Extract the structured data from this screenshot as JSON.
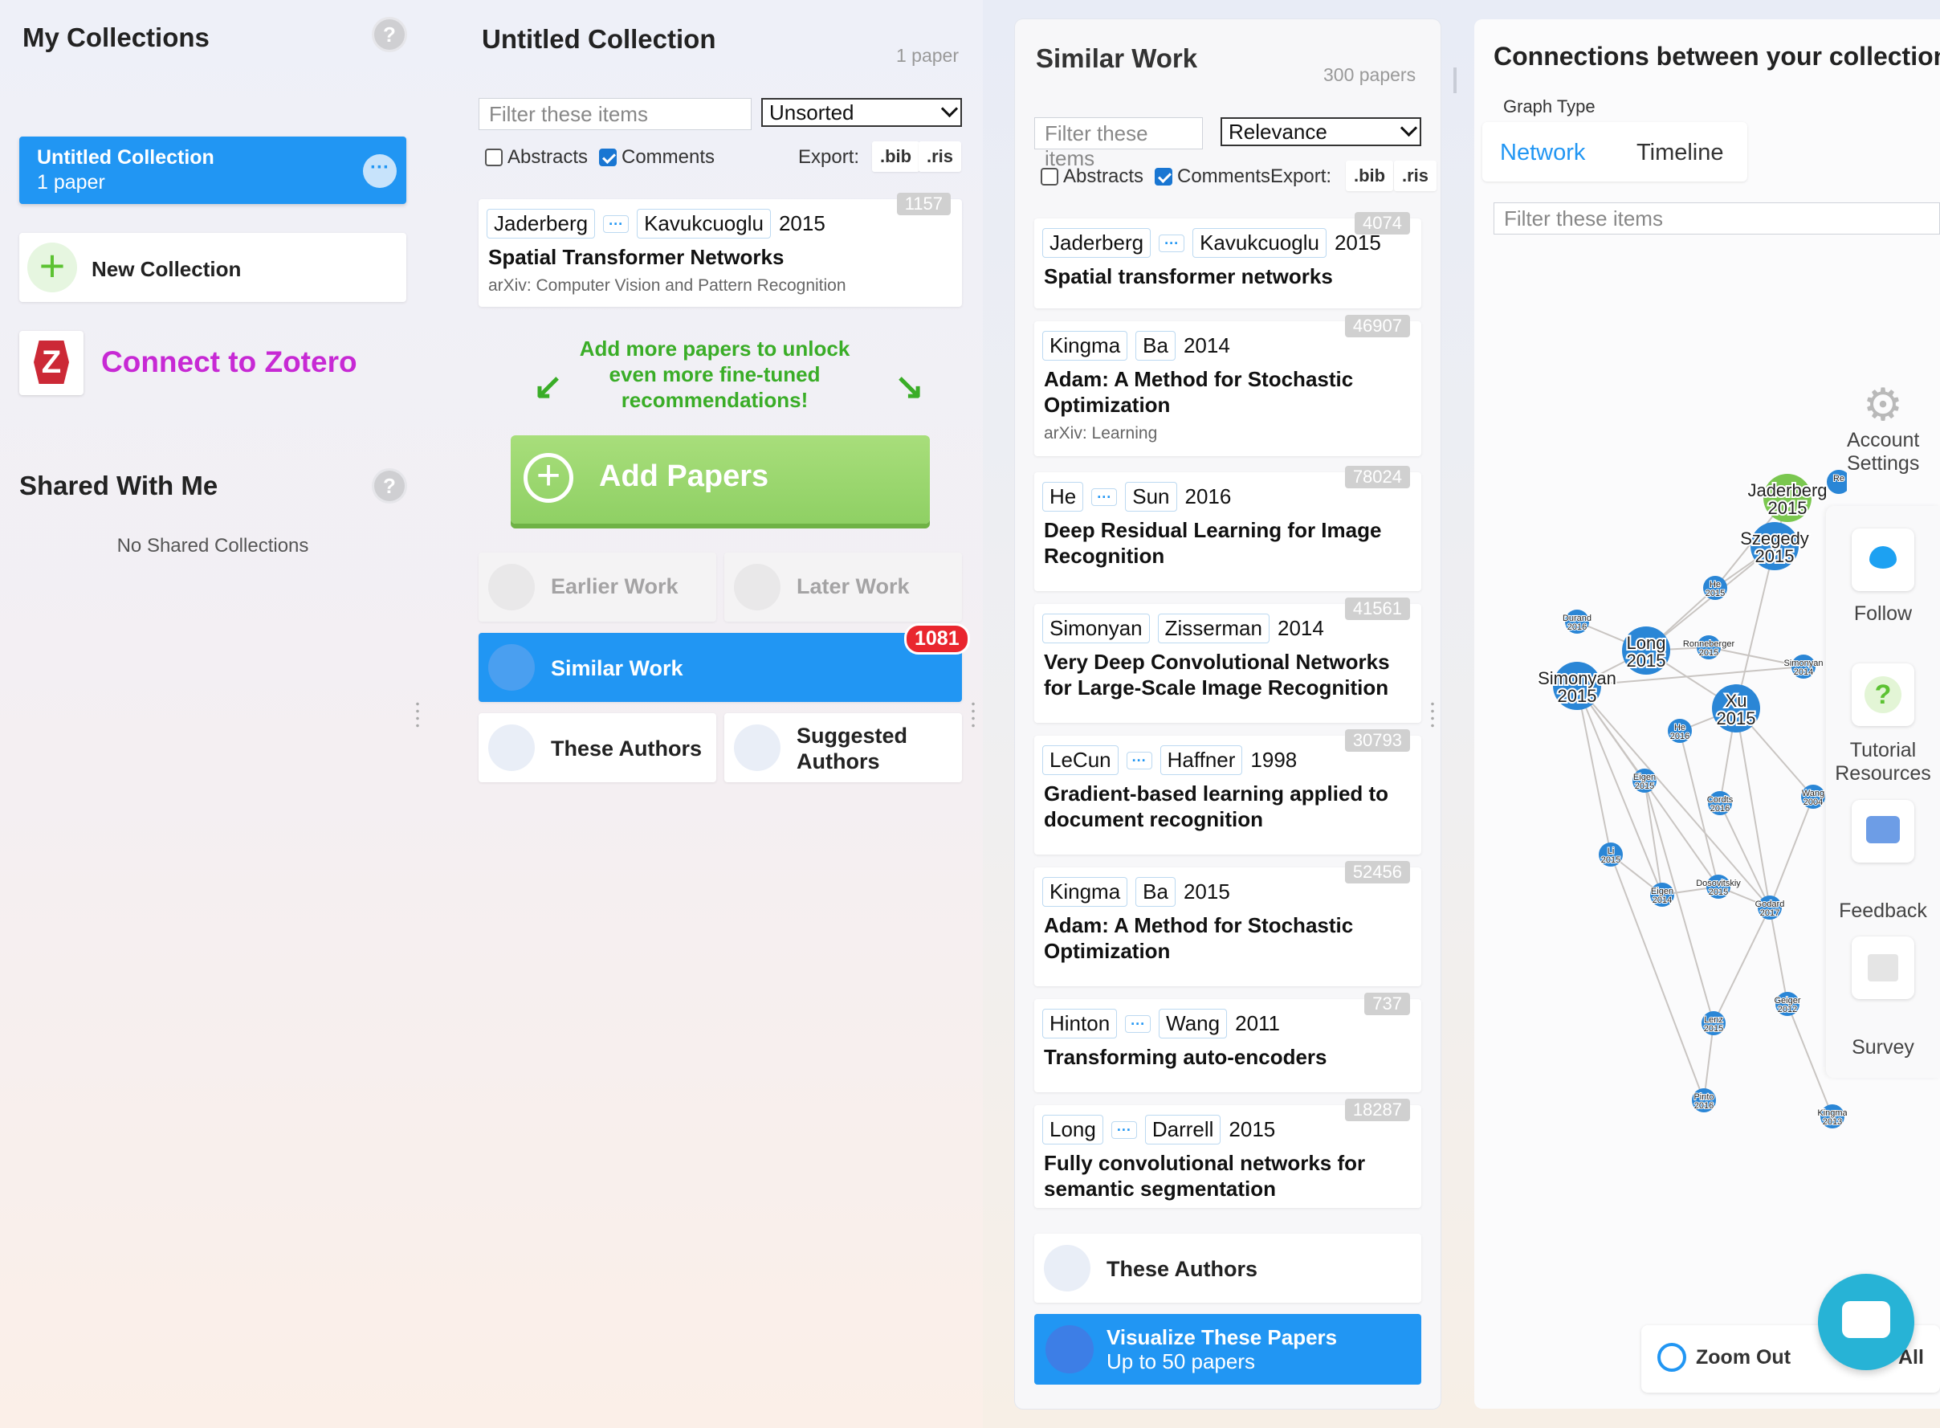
{
  "collections": {
    "title": "My Collections",
    "help": "?",
    "active": {
      "name": "Untitled Collection",
      "count": "1 paper",
      "more": "···"
    },
    "new_label": "New Collection",
    "zotero_letter": "Z",
    "zotero_label": "Connect to Zotero",
    "shared_title": "Shared With Me",
    "shared_empty": "No Shared Collections"
  },
  "collection": {
    "title": "Untitled Collection",
    "count": "1 paper",
    "filter_placeholder": "Filter these items",
    "sort_value": "Unsorted",
    "abstracts_label": "Abstracts",
    "comments_label": "Comments",
    "export_label": "Export:",
    "bib": ".bib",
    "ris": ".ris",
    "paper": {
      "author1": "Jaderberg",
      "author2": "Kavukcuoglu",
      "year": "2015",
      "cites": "1157",
      "title": "Spatial Transformer Networks",
      "venue": "arXiv: Computer Vision and Pattern Recognition"
    },
    "addmore_text": "Add more papers to unlock even more fine-tuned recommendations!",
    "add_papers": "Add Papers",
    "earlier_work": "Earlier Work",
    "later_work": "Later Work",
    "similar_work": "Similar Work",
    "similar_badge": "1081",
    "these_authors": "These Authors",
    "suggested_authors": "Suggested Authors"
  },
  "similar": {
    "title": "Similar Work",
    "count": "300 papers",
    "filter_placeholder": "Filter these items",
    "sort_value": "Relevance",
    "abstracts_label": "Abstracts",
    "comments_label": "Comments",
    "export_label": "Export:",
    "bib": ".bib",
    "ris": ".ris",
    "papers": [
      {
        "a1": "Jaderberg",
        "a2": "Kavukcuoglu",
        "dots": true,
        "year": "2015",
        "cites": "4074",
        "title": "Spatial transformer networks",
        "venue": ""
      },
      {
        "a1": "Kingma",
        "a2": "Ba",
        "dots": false,
        "year": "2014",
        "cites": "46907",
        "title": "Adam: A Method for Stochastic Optimization",
        "venue": "arXiv: Learning"
      },
      {
        "a1": "He",
        "a2": "Sun",
        "dots": true,
        "year": "2016",
        "cites": "78024",
        "title": "Deep Residual Learning for Image Recognition",
        "venue": ""
      },
      {
        "a1": "Simonyan",
        "a2": "Zisserman",
        "dots": false,
        "year": "2014",
        "cites": "41561",
        "title": "Very Deep Convolutional Networks for Large-Scale Image Recognition",
        "venue": ""
      },
      {
        "a1": "LeCun",
        "a2": "Haffner",
        "dots": true,
        "year": "1998",
        "cites": "30793",
        "title": "Gradient-based learning applied to document recognition",
        "venue": ""
      },
      {
        "a1": "Kingma",
        "a2": "Ba",
        "dots": false,
        "year": "2015",
        "cites": "52456",
        "title": "Adam: A Method for Stochastic Optimization",
        "venue": ""
      },
      {
        "a1": "Hinton",
        "a2": "Wang",
        "dots": true,
        "year": "2011",
        "cites": "737",
        "title": "Transforming auto-encoders",
        "venue": ""
      },
      {
        "a1": "Long",
        "a2": "Darrell",
        "dots": true,
        "year": "2015",
        "cites": "18287",
        "title": "Fully convolutional networks for semantic segmentation",
        "venue": ""
      }
    ],
    "these_authors": "These Authors",
    "visualize_title": "Visualize These Papers",
    "visualize_sub": "Up to 50 papers"
  },
  "graph": {
    "title": "Connections between your collection",
    "graph_type_label": "Graph Type",
    "tab_network": "Network",
    "tab_timeline": "Timeline",
    "filter_placeholder": "Filter these items",
    "nodes": [
      {
        "name": "Jaderberg",
        "year": "2015",
        "big": true
      },
      {
        "name": "Szegedy",
        "year": "2015",
        "big": true
      },
      {
        "name": "Long",
        "year": "2015",
        "big": true
      },
      {
        "name": "Simonyan",
        "year": "2015",
        "big": true
      },
      {
        "name": "Xu",
        "year": "2015",
        "big": true
      },
      {
        "name": "He",
        "year": "2015",
        "big": false
      },
      {
        "name": "Durand",
        "year": "2016",
        "big": false
      },
      {
        "name": "Ronneberger",
        "year": "2015",
        "big": false
      },
      {
        "name": "Simonyan",
        "year": "2014",
        "big": false
      },
      {
        "name": "He",
        "year": "2016",
        "big": false
      },
      {
        "name": "Eigen",
        "year": "2015",
        "big": false
      },
      {
        "name": "Cordts",
        "year": "2016",
        "big": false
      },
      {
        "name": "Wang",
        "year": "2004",
        "big": false
      },
      {
        "name": "Li",
        "year": "2015",
        "big": false
      },
      {
        "name": "Eigen",
        "year": "2014",
        "big": false
      },
      {
        "name": "Dosovitskiy",
        "year": "2015",
        "big": false
      },
      {
        "name": "Godard",
        "year": "2017",
        "big": false
      },
      {
        "name": "Geiger",
        "year": "2012",
        "big": false
      },
      {
        "name": "Lenz",
        "year": "2015",
        "big": false
      },
      {
        "name": "Pinto",
        "year": "2016",
        "big": false
      },
      {
        "name": "Kingma",
        "year": "2013",
        "big": false
      },
      {
        "name": "Re",
        "year": "",
        "big": false
      }
    ],
    "account_settings": "Account Settings",
    "follow": "Follow",
    "tutorial": "Tutorial Resources",
    "feedback": "Feedback",
    "survey": "Survey",
    "zoom_out": "Zoom Out",
    "zoom_all": "All"
  }
}
